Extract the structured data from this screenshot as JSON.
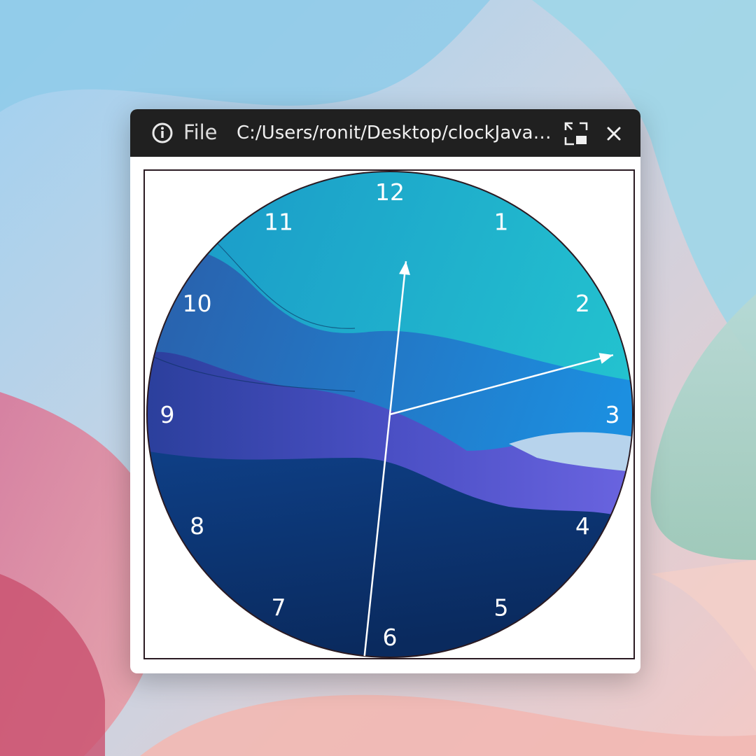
{
  "window": {
    "file_label": "File",
    "path": "C:/Users/ronit/Desktop/clockJavaS...",
    "icons": {
      "info": "info-circle-icon",
      "restore": "restore-window-icon",
      "close": "close-icon"
    }
  },
  "clock": {
    "numerals": [
      "12",
      "1",
      "2",
      "3",
      "4",
      "5",
      "6",
      "7",
      "8",
      "9",
      "10",
      "11"
    ],
    "time": {
      "hour": 12,
      "minute": 12,
      "second": 31
    },
    "colors": {
      "hands": "#ffffff",
      "rim": "#2a1a22",
      "face_top": "#1fb8cc",
      "face_mid": "#2f6fc0",
      "face_band": "#5a5ed6",
      "face_bottom": "#0c3a7a"
    }
  }
}
